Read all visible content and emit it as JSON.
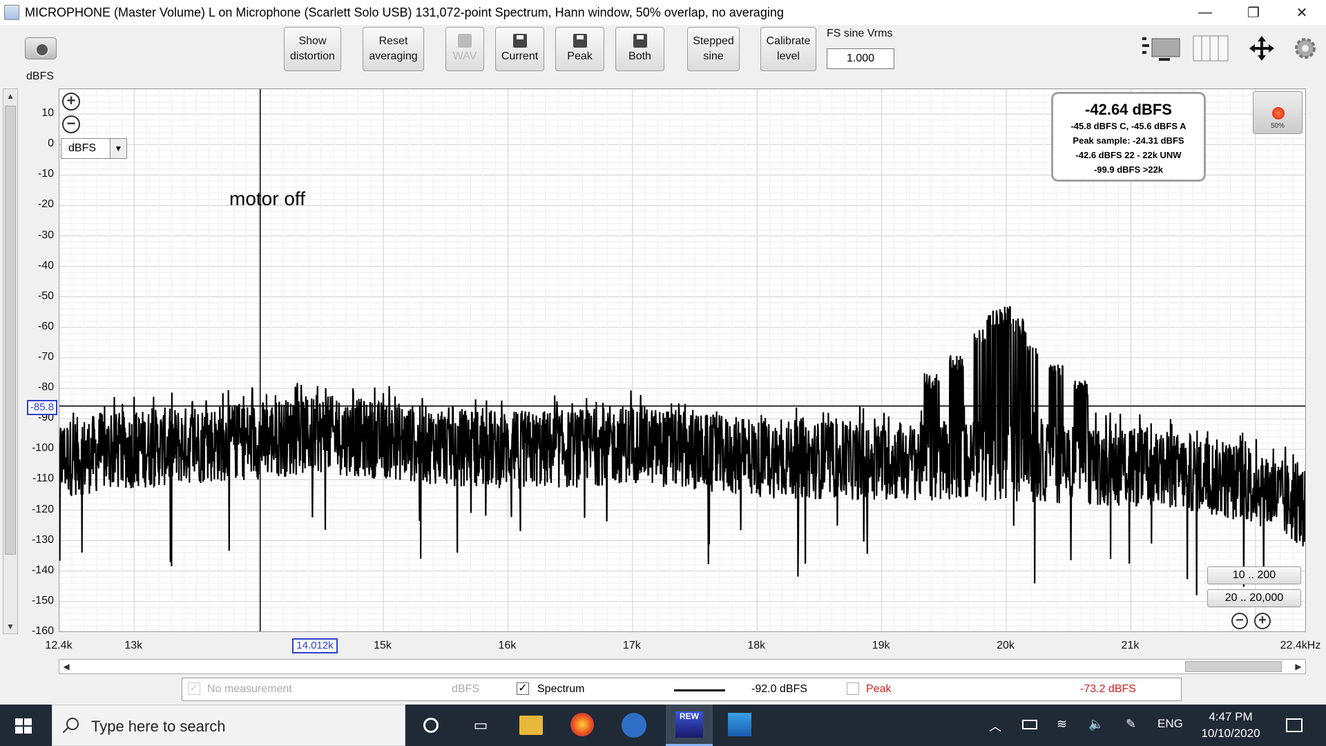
{
  "window": {
    "title": "MICROPHONE (Master Volume) L on Microphone (Scarlett Solo USB) 131,072-point Spectrum, Hann window, 50% overlap, no averaging",
    "minimize": "—",
    "restore": "❐",
    "close": "✕"
  },
  "toolbar": {
    "show_distortion": [
      "Show",
      "distortion"
    ],
    "reset_averaging": [
      "Reset",
      "averaging"
    ],
    "wav": "WAV",
    "current": "Current",
    "peak": "Peak",
    "both": "Both",
    "stepped_sine": [
      "Stepped",
      "sine"
    ],
    "calibrate_level": [
      "Calibrate",
      "level"
    ],
    "fs_label": "FS sine Vrms",
    "fs_value": "1.000"
  },
  "plot": {
    "y_unit": "dBFS",
    "unit_select": "dBFS",
    "annotation": "motor off",
    "cursor_y": "-85.8",
    "cursor_x": "14.012k",
    "zoom_in": "+",
    "zoom_out": "−"
  },
  "level_box": {
    "main": "-42.64 dBFS",
    "line1": "-45.8 dBFS C, -45.6 dBFS A",
    "line2": "Peak sample: -24.31 dBFS",
    "line3": "-42.6 dBFS 22 - 22k UNW",
    "line4": "-99.9 dBFS >22k"
  },
  "record": {
    "percent": "50%"
  },
  "ranges": {
    "r1": "10 .. 200",
    "r2": "20 .. 20,000"
  },
  "legend": {
    "no_measurement": "No measurement",
    "no_measurement_unit": "dBFS",
    "spectrum": "Spectrum",
    "spectrum_value": "-92.0 dBFS",
    "peak": "Peak",
    "peak_value": "-73.2 dBFS",
    "peak_color": "#d02020"
  },
  "taskbar": {
    "search_placeholder": "Type here to search",
    "lang": "ENG",
    "time": "4:47 PM",
    "date": "10/10/2020"
  },
  "chart_data": {
    "type": "line",
    "xlabel": "",
    "ylabel": "dBFS",
    "xlim": [
      12400,
      22400
    ],
    "ylim": [
      -160,
      20
    ],
    "y_ticks": [
      10,
      0,
      -10,
      -20,
      -30,
      -40,
      -50,
      -60,
      -70,
      -80,
      -90,
      -100,
      -110,
      -120,
      -130,
      -140,
      -150,
      -160
    ],
    "x_ticks": [
      {
        "v": 12400,
        "label": "12.4k"
      },
      {
        "v": 13000,
        "label": "13k"
      },
      {
        "v": 15000,
        "label": "15k"
      },
      {
        "v": 16000,
        "label": "16k"
      },
      {
        "v": 17000,
        "label": "17k"
      },
      {
        "v": 18000,
        "label": "18k"
      },
      {
        "v": 19000,
        "label": "19k"
      },
      {
        "v": 20000,
        "label": "20k"
      },
      {
        "v": 21000,
        "label": "21k"
      },
      {
        "v": 22400,
        "label": "22.4kHz"
      }
    ],
    "cursor": {
      "x": 14012,
      "y": -85.8
    },
    "series": [
      {
        "name": "Spectrum",
        "baseline": [
          [
            12400,
            -103
          ],
          [
            13000,
            -100
          ],
          [
            14000,
            -97
          ],
          [
            14500,
            -95
          ],
          [
            15000,
            -97
          ],
          [
            15500,
            -99
          ],
          [
            16000,
            -100
          ],
          [
            16500,
            -100
          ],
          [
            17000,
            -98
          ],
          [
            17500,
            -101
          ],
          [
            18000,
            -103
          ],
          [
            19000,
            -104
          ],
          [
            20000,
            -104
          ],
          [
            21000,
            -106
          ],
          [
            21500,
            -108
          ],
          [
            22000,
            -112
          ],
          [
            22400,
            -120
          ]
        ],
        "peaks": [
          [
            19400,
            -78
          ],
          [
            19600,
            -72
          ],
          [
            19800,
            -63
          ],
          [
            19900,
            -57
          ],
          [
            20000,
            -56
          ],
          [
            20100,
            -60
          ],
          [
            20200,
            -66
          ],
          [
            20400,
            -73
          ],
          [
            20600,
            -80
          ]
        ]
      }
    ]
  }
}
